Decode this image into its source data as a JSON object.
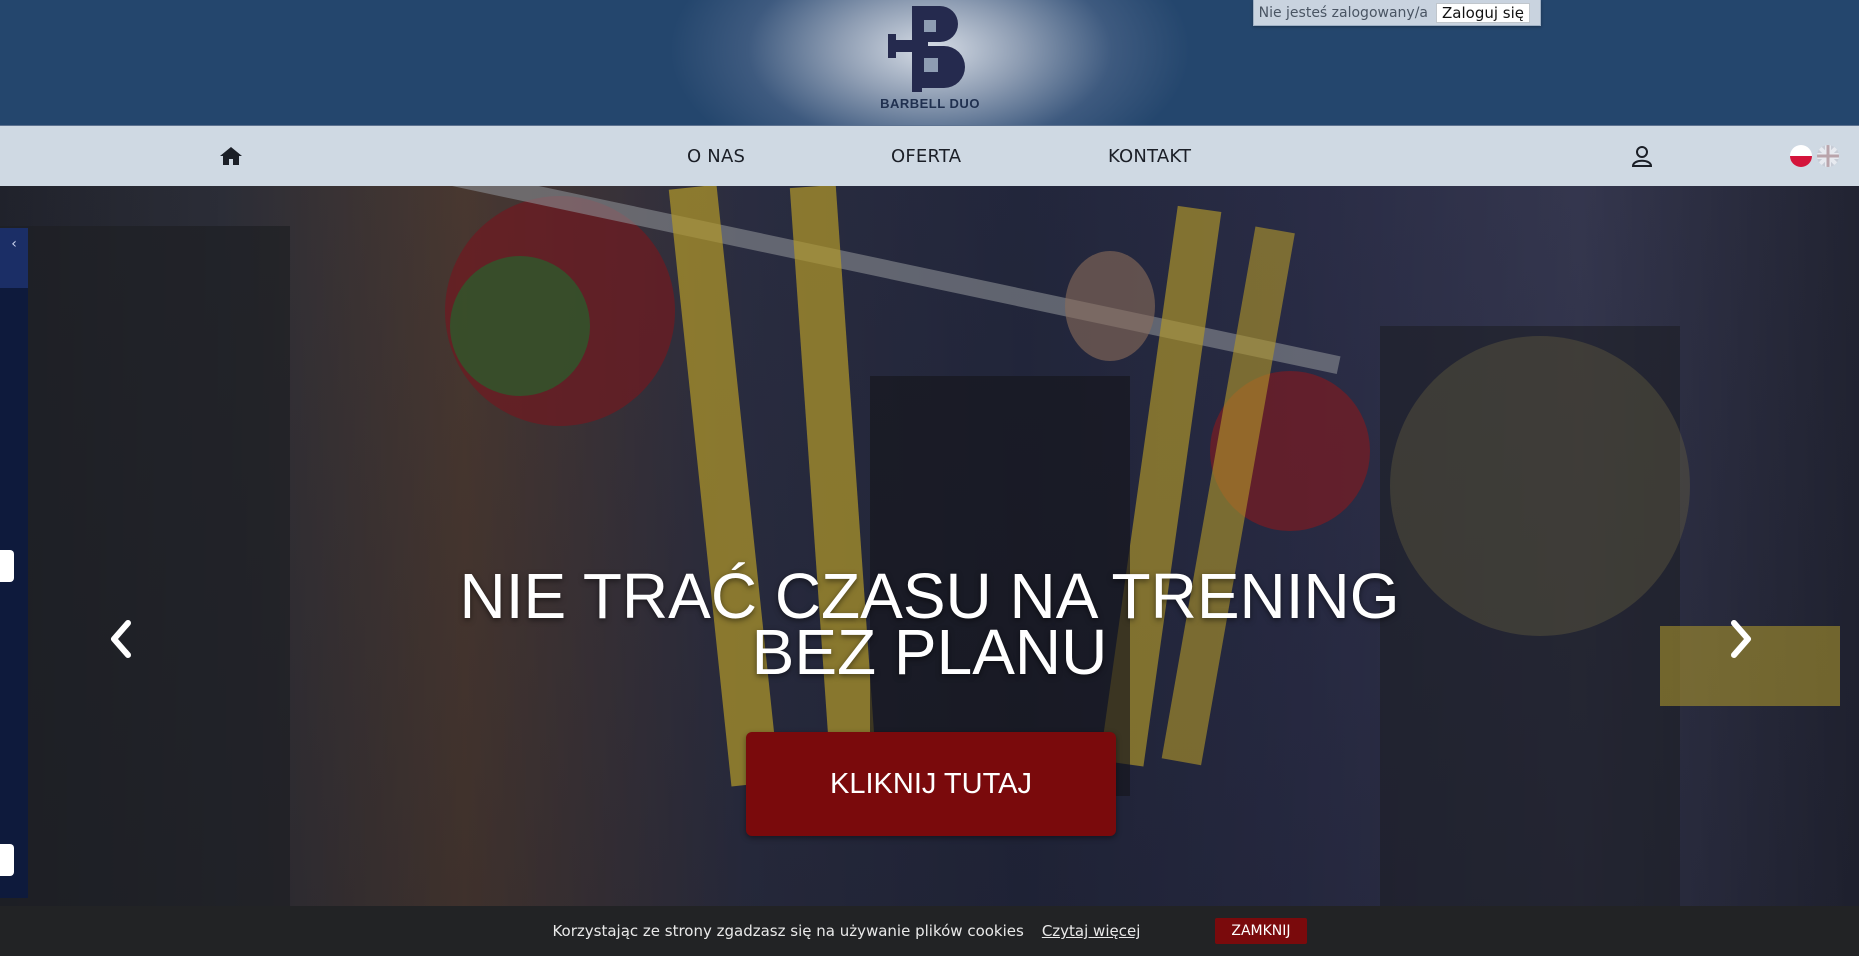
{
  "header": {
    "brand_name": "BARBELL DUO",
    "login_status": "Nie jesteś zalogowany/a",
    "login_button": "Zaloguj się"
  },
  "nav": {
    "home_icon": "home-icon",
    "items": [
      {
        "label": "O NAS"
      },
      {
        "label": "OFERTA"
      },
      {
        "label": "KONTAKT"
      }
    ],
    "user_icon": "user-icon",
    "languages": [
      "pl-flag",
      "en-flag"
    ]
  },
  "hero": {
    "title_line1": "NIE TRAĆ CZASU NA TRENING",
    "title_line2": "BEZ PLANU",
    "cta_label": "KLIKNIJ TUTAJ",
    "prev_icon": "chevron-left-icon",
    "next_icon": "chevron-right-icon"
  },
  "cookie_bar": {
    "text": "Korzystając ze strony zgadzasz się na używanie plików cookies",
    "link": "Czytaj więcej",
    "close_button": "ZAMKNIJ"
  },
  "colors": {
    "header_bg": "#24466d",
    "nav_bg": "#cfd9e3",
    "cta_bg": "#7a0a0c",
    "cookie_bg": "#222325"
  }
}
